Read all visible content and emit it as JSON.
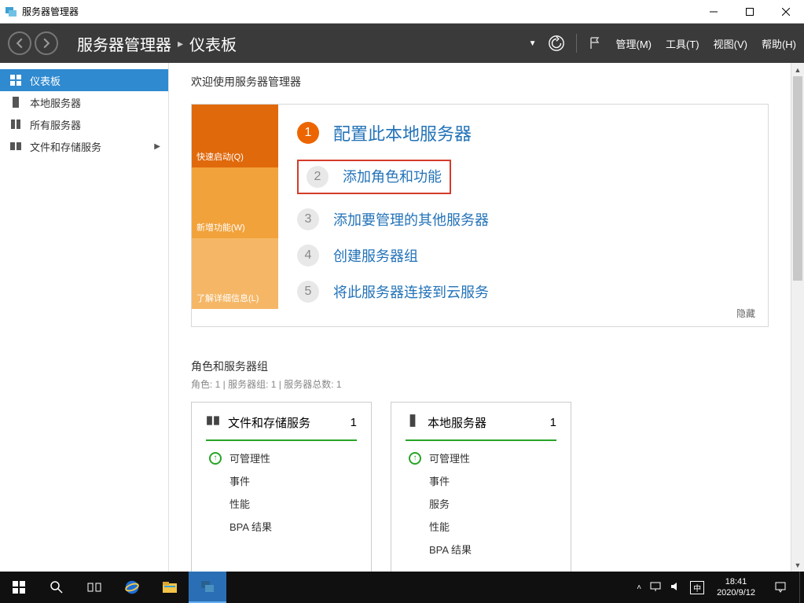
{
  "window": {
    "title": "服务器管理器"
  },
  "header": {
    "breadcrumb_app": "服务器管理器",
    "breadcrumb_page": "仪表板",
    "menu": {
      "manage": "管理(M)",
      "tools": "工具(T)",
      "view": "视图(V)",
      "help": "帮助(H)"
    }
  },
  "sidebar": {
    "items": [
      {
        "label": "仪表板"
      },
      {
        "label": "本地服务器"
      },
      {
        "label": "所有服务器"
      },
      {
        "label": "文件和存储服务"
      }
    ]
  },
  "welcome": {
    "title": "欢迎使用服务器管理器",
    "left": {
      "quickstart": "快速启动(Q)",
      "whatsnew": "新增功能(W)",
      "learnmore": "了解详细信息(L)"
    },
    "steps": {
      "s1": "配置此本地服务器",
      "s2": "添加角色和功能",
      "s3": "添加要管理的其他服务器",
      "s4": "创建服务器组",
      "s5": "将此服务器连接到云服务"
    },
    "hide": "隐藏"
  },
  "roles": {
    "title": "角色和服务器组",
    "subtitle": "角色: 1 | 服务器组: 1 | 服务器总数: 1",
    "tile1": {
      "title": "文件和存储服务",
      "count": "1",
      "rows": {
        "manage": "可管理性",
        "events": "事件",
        "perf": "性能",
        "bpa": "BPA 结果"
      }
    },
    "tile2": {
      "title": "本地服务器",
      "count": "1",
      "rows": {
        "manage": "可管理性",
        "events": "事件",
        "services": "服务",
        "perf": "性能",
        "bpa": "BPA 结果"
      }
    }
  },
  "taskbar": {
    "time": "18:41",
    "date": "2020/9/12",
    "ime": "中"
  }
}
